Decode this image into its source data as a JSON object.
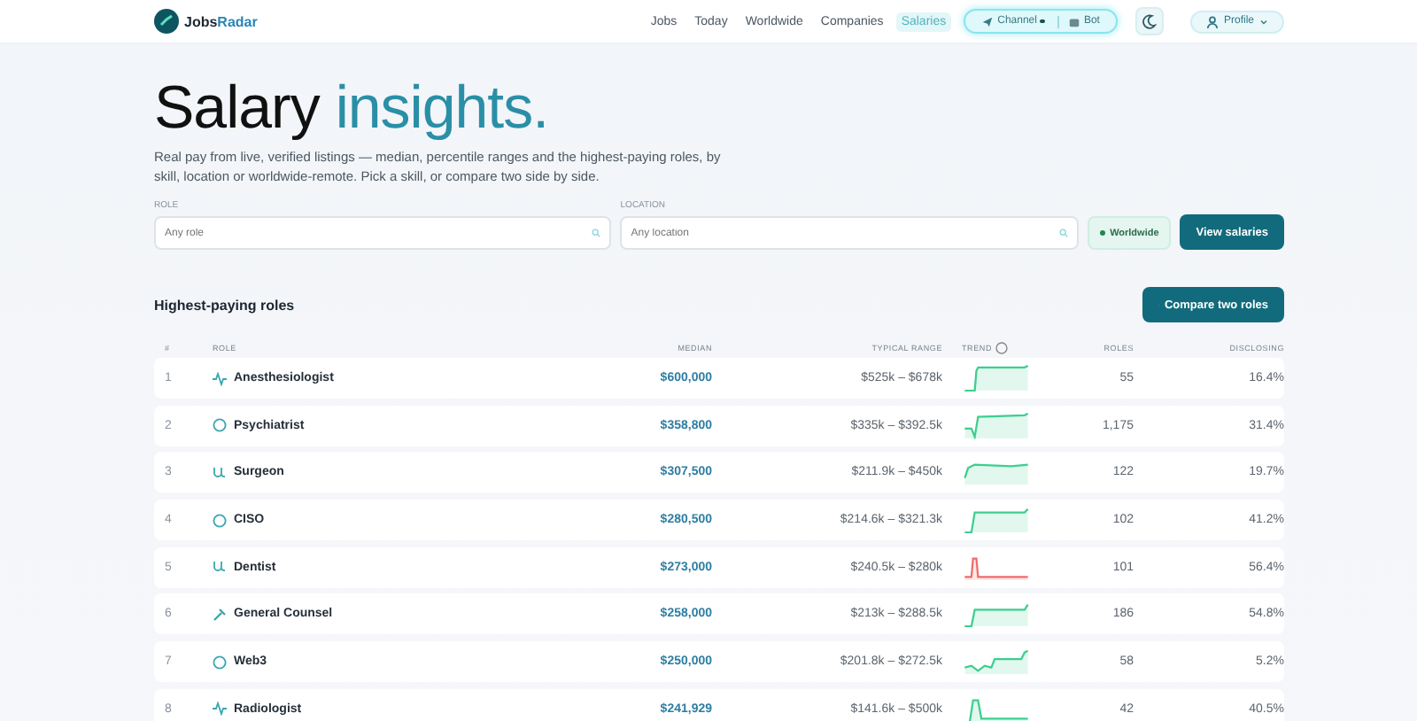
{
  "logo": {
    "first": "Jobs",
    "second": "Radar"
  },
  "nav": [
    {
      "label": "Jobs",
      "selected": false
    },
    {
      "label": "Today",
      "selected": false
    },
    {
      "label": "Worldwide",
      "selected": false
    },
    {
      "label": "Companies",
      "selected": false
    },
    {
      "label": "Salaries",
      "selected": true
    }
  ],
  "channels": [
    {
      "label": "Channel",
      "kind": "channel"
    },
    {
      "label": "Bot",
      "kind": "bot"
    }
  ],
  "profile": "Profile",
  "hero": {
    "title": "Salary",
    "accent": "insights.",
    "text": "Real pay from live, verified listings — median, percentile ranges and the highest-paying roles, by skill, location or worldwide-remote. Pick a skill, or compare two side by side."
  },
  "search": {
    "role_label": "ROLE",
    "role_placeholder": "Any role",
    "location_label": "LOCATION",
    "location_placeholder": "Any location",
    "worldwide": "Worldwide",
    "worldwide_on": true,
    "submit": "View salaries"
  },
  "section": {
    "title": "Highest-paying roles",
    "compare": "Compare two roles"
  },
  "columns": [
    "#",
    "ROLE",
    "MEDIAN",
    "TYPICAL RANGE",
    "TREND",
    "ROLES",
    "DISCLOSING"
  ],
  "rows": [
    {
      "rank": "1",
      "role": "Anesthesiologist",
      "median": "$600,000",
      "range": "$525k – $678k",
      "roles": "55",
      "disclosing": "16.4%"
    },
    {
      "rank": "2",
      "role": "Psychiatrist",
      "median": "$358,800",
      "range": "$335k – $392.5k",
      "roles": "1,175",
      "disclosing": "31.4%"
    },
    {
      "rank": "3",
      "role": "Surgeon",
      "median": "$307,500",
      "range": "$211.9k – $450k",
      "roles": "122",
      "disclosing": "19.7%"
    },
    {
      "rank": "4",
      "role": "CISO",
      "median": "$280,500",
      "range": "$214.6k – $321.3k",
      "roles": "102",
      "disclosing": "41.2%"
    },
    {
      "rank": "5",
      "role": "Dentist",
      "median": "$273,000",
      "range": "$240.5k – $280k",
      "roles": "101",
      "disclosing": "56.4%"
    },
    {
      "rank": "6",
      "role": "General Counsel",
      "median": "$258,000",
      "range": "$213k – $288.5k",
      "roles": "186",
      "disclosing": "54.8%"
    },
    {
      "rank": "7",
      "role": "Web3",
      "median": "$250,000",
      "range": "$201.8k – $272.5k",
      "roles": "58",
      "disclosing": "5.2%"
    },
    {
      "rank": "8",
      "role": "Radiologist",
      "median": "$241,929",
      "range": "$141.6k – $500k",
      "roles": "42",
      "disclosing": "40.5%"
    }
  ]
}
